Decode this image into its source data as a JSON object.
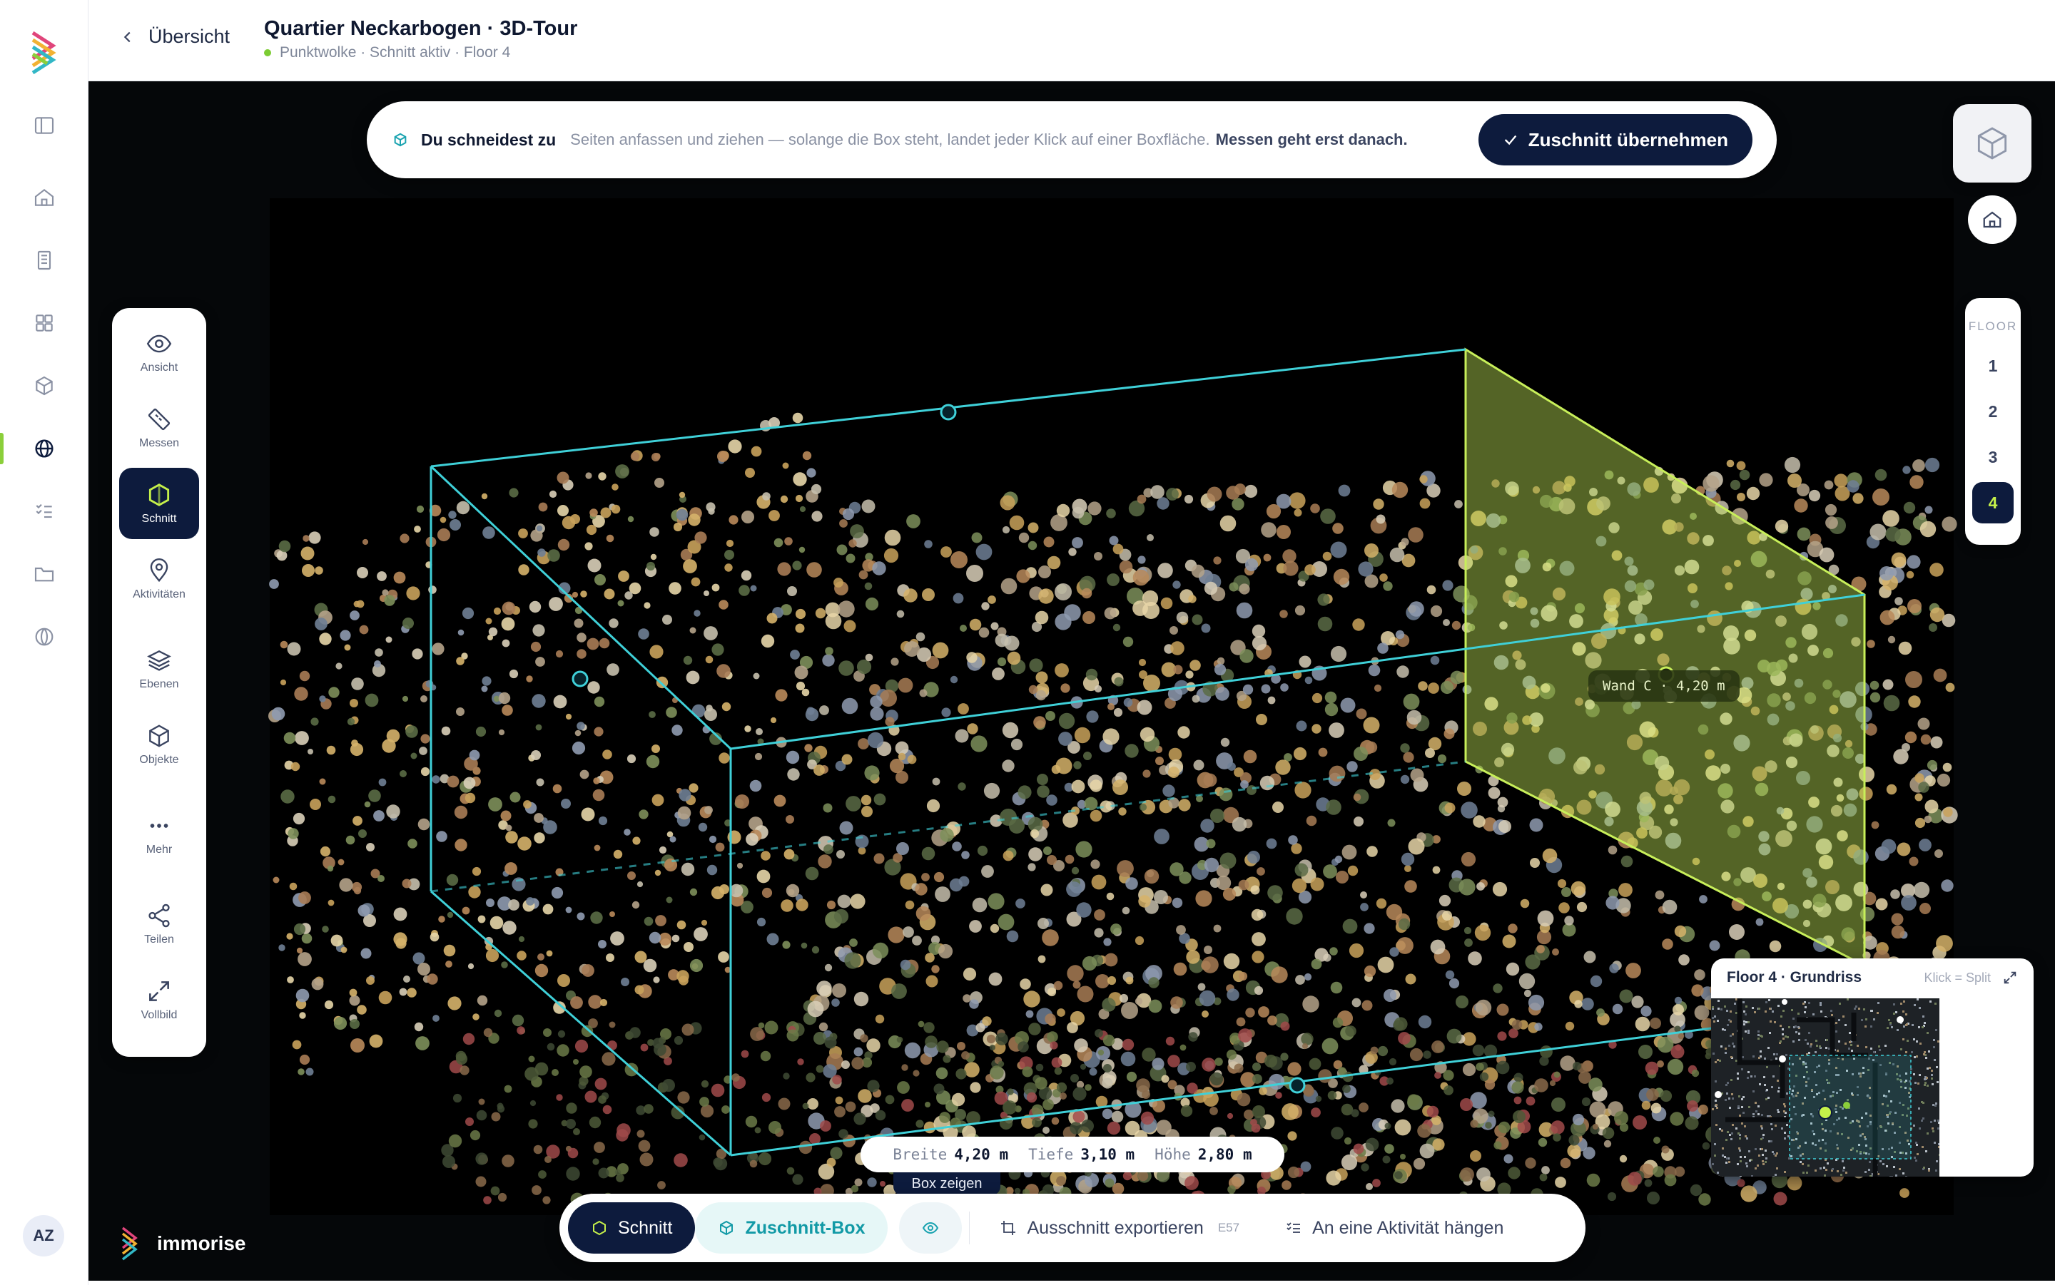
{
  "header": {
    "back_label": "Übersicht",
    "title": "Quartier Neckarbogen · 3D-Tour",
    "subtitle": "Punktwolke · Schnitt aktiv · Floor 4"
  },
  "rail": {
    "avatar": "AZ",
    "icons": [
      "sidebar-toggle-icon",
      "home-icon",
      "building-icon",
      "grid-icon",
      "cube-icon",
      "globe-icon",
      "checklist-icon",
      "folder-icon",
      "pano-icon"
    ],
    "active_index": 5
  },
  "banner": {
    "lead": "Du schneidest zu",
    "text": "Seiten anfassen und ziehen — solange die Box steht, landet jeder Klick auf einer Boxfläche.",
    "strong": "Messen geht erst danach.",
    "apply_label": "Zuschnitt übernehmen"
  },
  "tools": [
    {
      "label": "Ansicht",
      "icon": "eye-icon"
    },
    {
      "label": "Messen",
      "icon": "ruler-icon"
    },
    {
      "label": "Schnitt",
      "icon": "section-icon"
    },
    {
      "label": "Aktivitäten",
      "icon": "pin-icon"
    },
    {
      "label": "Ebenen",
      "icon": "layers-icon"
    },
    {
      "label": "Objekte",
      "icon": "cube-icon"
    },
    {
      "label": "Mehr",
      "icon": "more-icon"
    },
    {
      "label": "Teilen",
      "icon": "share-icon"
    },
    {
      "label": "Vollbild",
      "icon": "fullscreen-icon"
    }
  ],
  "active_tool": "Schnitt",
  "floors": {
    "label": "FLOOR",
    "items": [
      "1",
      "2",
      "3",
      "4"
    ],
    "active": "4"
  },
  "wall_label": "Wand C · 4,20 m",
  "dims": {
    "breite_label": "Breite",
    "breite": "4,20 m",
    "tiefe_label": "Tiefe",
    "tiefe": "3,10 m",
    "hoehe_label": "Höhe",
    "hoehe": "2,80 m"
  },
  "tooltip": "Box zeigen",
  "toolbar": {
    "schnitt": "Schnitt",
    "box": "Zuschnitt-Box",
    "export": "Ausschnitt exportieren",
    "export_kbd": "E57",
    "attach": "An eine Aktivität hängen"
  },
  "minimap": {
    "title": "Floor 4 · Grundriss",
    "hint": "Klick = Split"
  },
  "brand": "immorise",
  "colors": {
    "navy": "#0d1b3d",
    "accent_lime": "#c5f04a",
    "box_cyan": "#3fd0d8",
    "wall_lime": "#c8ef5a",
    "status_green": "#7ccc33"
  }
}
